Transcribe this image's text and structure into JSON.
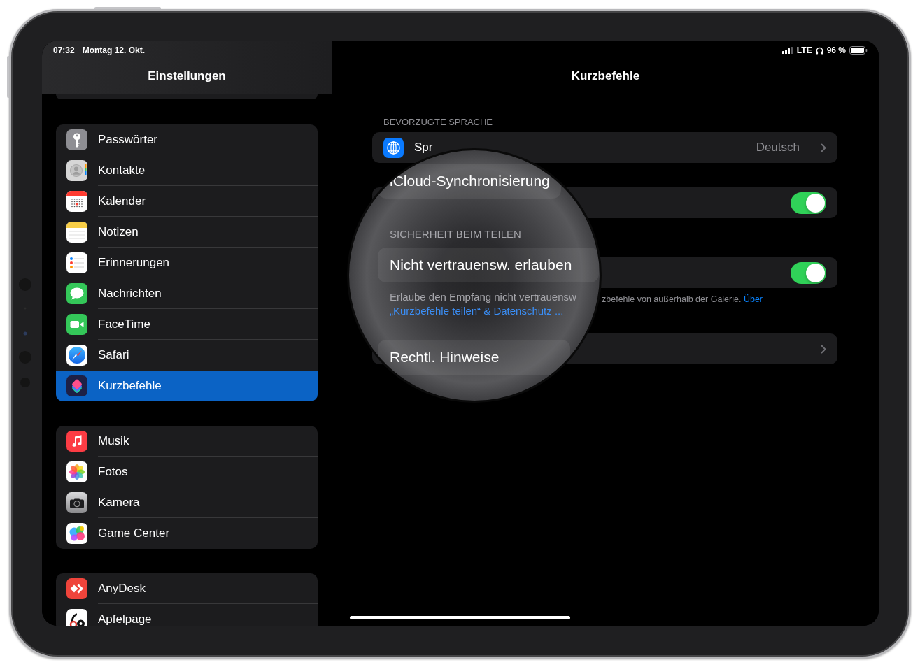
{
  "status_bar": {
    "time": "07:32",
    "date": "Montag 12. Okt.",
    "network": "LTE",
    "battery": "96 %"
  },
  "sidebar": {
    "title": "Einstellungen",
    "groups": [
      {
        "items": [
          {
            "label": "Passwörter",
            "selected": false
          },
          {
            "label": "Kontakte",
            "selected": false
          },
          {
            "label": "Kalender",
            "selected": false
          },
          {
            "label": "Notizen",
            "selected": false
          },
          {
            "label": "Erinnerungen",
            "selected": false
          },
          {
            "label": "Nachrichten",
            "selected": false
          },
          {
            "label": "FaceTime",
            "selected": false
          },
          {
            "label": "Safari",
            "selected": false
          },
          {
            "label": "Kurzbefehle",
            "selected": true
          }
        ]
      },
      {
        "items": [
          {
            "label": "Musik",
            "selected": false
          },
          {
            "label": "Fotos",
            "selected": false
          },
          {
            "label": "Kamera",
            "selected": false
          },
          {
            "label": "Game Center",
            "selected": false
          }
        ]
      },
      {
        "items": [
          {
            "label": "AnyDesk",
            "selected": false
          },
          {
            "label": "Apfelpage",
            "selected": false
          }
        ]
      }
    ]
  },
  "detail": {
    "title": "Kurzbefehle",
    "sections": [
      {
        "header": "BEVORZUGTE SPRACHE",
        "rows": [
          {
            "kind": "value",
            "label": "Spr",
            "value": "Deutsch"
          }
        ]
      },
      {
        "rows": [
          {
            "kind": "toggle",
            "on": true
          }
        ]
      },
      {
        "rows": [
          {
            "kind": "toggle",
            "on": true
          }
        ],
        "footer": {
          "text": "zbefehle von außerhalb der Galerie.",
          "link": "Über"
        }
      },
      {
        "rows": [
          {
            "kind": "link"
          }
        ]
      }
    ]
  },
  "magnifier": {
    "items": [
      {
        "kind": "row",
        "label": "iCloud-Synchronisierung"
      },
      {
        "kind": "header",
        "text": "SICHERHEIT BEIM TEILEN"
      },
      {
        "kind": "row",
        "label": "Nicht vertrauensw. erlauben"
      },
      {
        "kind": "footer",
        "text": "Erlaube den Empfang nicht vertrauensw",
        "link": "„Kurzbefehle teilen“ & Datenschutz ..."
      },
      {
        "kind": "row",
        "label": "Rechtl. Hinweise"
      }
    ]
  }
}
